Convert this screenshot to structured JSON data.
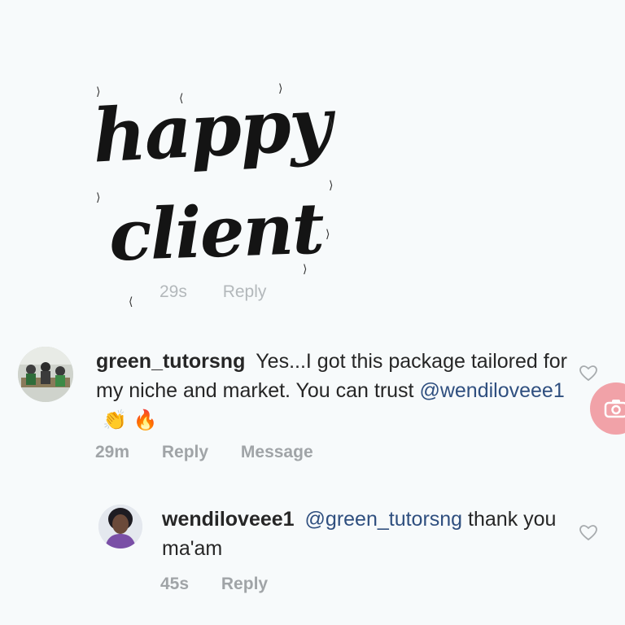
{
  "overlay": {
    "line1": "happy",
    "line2": "client"
  },
  "hidden_comment": {
    "time": "29s",
    "reply": "Reply"
  },
  "comments": [
    {
      "username": "green_tutorsng",
      "text": "Yes...I got this package tailored for my niche and market. You can trust",
      "mention": "@wendiloveee1",
      "emoji": [
        "clapping-hands",
        "fire"
      ],
      "time": "29m",
      "reply": "Reply",
      "message": "Message"
    },
    {
      "username": "wendiloveee1",
      "mention": "@green_tutorsng",
      "text": "thank you ma'am",
      "time": "45s",
      "reply": "Reply"
    }
  ],
  "colors": {
    "background": "#f7fafb",
    "mention": "#2f4f7f",
    "meta": "#a0a4a7",
    "fab": "#f1a2a8"
  },
  "icons": [
    "heart-icon",
    "camera-icon"
  ]
}
